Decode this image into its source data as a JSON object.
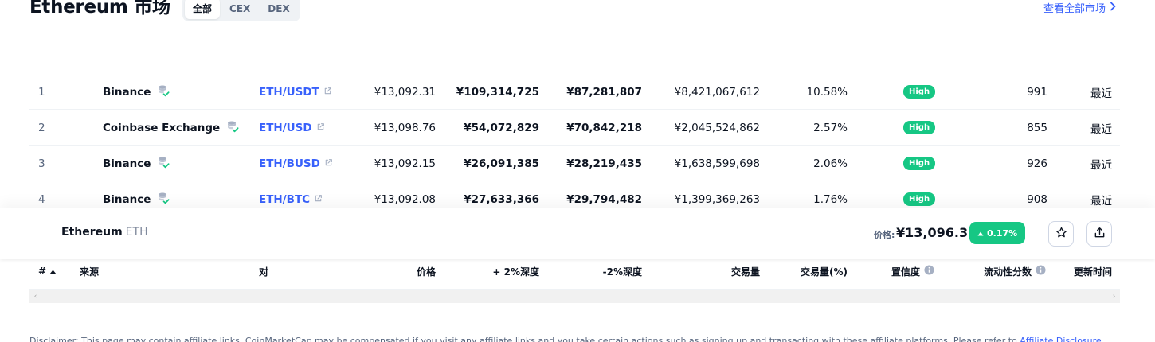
{
  "header": {
    "title": "Ethereum 市场",
    "tabs": [
      "全部",
      "CEX",
      "DEX"
    ],
    "active_tab": "全部",
    "view_all": "查看全部市场"
  },
  "rows": [
    {
      "rank": "1",
      "source": "Binance",
      "pair": "ETH/USDT",
      "price": "¥13,092.31",
      "depth_plus": "¥109,314,725",
      "depth_minus": "¥87,281,807",
      "volume": "¥8,421,067,612",
      "volume_pct": "10.58%",
      "confidence": "High",
      "liquidity": "991",
      "updated": "最近"
    },
    {
      "rank": "2",
      "source": "Coinbase Exchange",
      "pair": "ETH/USD",
      "price": "¥13,098.76",
      "depth_plus": "¥54,072,829",
      "depth_minus": "¥70,842,218",
      "volume": "¥2,045,524,862",
      "volume_pct": "2.57%",
      "confidence": "High",
      "liquidity": "855",
      "updated": "最近"
    },
    {
      "rank": "3",
      "source": "Binance",
      "pair": "ETH/BUSD",
      "price": "¥13,092.15",
      "depth_plus": "¥26,091,385",
      "depth_minus": "¥28,219,435",
      "volume": "¥1,638,599,698",
      "volume_pct": "2.06%",
      "confidence": "High",
      "liquidity": "926",
      "updated": "最近"
    },
    {
      "rank": "4",
      "source": "Binance",
      "pair": "ETH/BTC",
      "price": "¥13,092.08",
      "depth_plus": "¥27,633,366",
      "depth_minus": "¥29,794,482",
      "volume": "¥1,399,369,263",
      "volume_pct": "1.76%",
      "confidence": "High",
      "liquidity": "908",
      "updated": "最近"
    }
  ],
  "sticky": {
    "name": "Ethereum",
    "symbol": "ETH",
    "price_label": "价格:",
    "price": "¥13,096.35",
    "change": "0.17%"
  },
  "columns": {
    "rank": "#",
    "source": "来源",
    "pair": "对",
    "price": "价格",
    "depth_plus": "+ 2%深度",
    "depth_minus": "-2%深度",
    "volume": "交易量",
    "volume_pct": "交易量(%)",
    "confidence": "置信度",
    "liquidity": "流动性分数",
    "updated": "更新时间"
  },
  "disclaimer": {
    "text": "Disclaimer: This page may contain affiliate links. CoinMarketCap may be compensated if you visit any affiliate links and you take certain actions such as signing up and transacting with these affiliate platforms. Please refer to ",
    "link": "Affiliate Disclosure"
  },
  "colors": {
    "accent": "#3861fb",
    "positive": "#16c784"
  },
  "icons": [
    "coin-stack-verified-icon",
    "external-link-icon",
    "chevron-right-icon",
    "caret-up-icon",
    "star-icon",
    "share-icon",
    "info-icon",
    "sort-up-icon"
  ]
}
